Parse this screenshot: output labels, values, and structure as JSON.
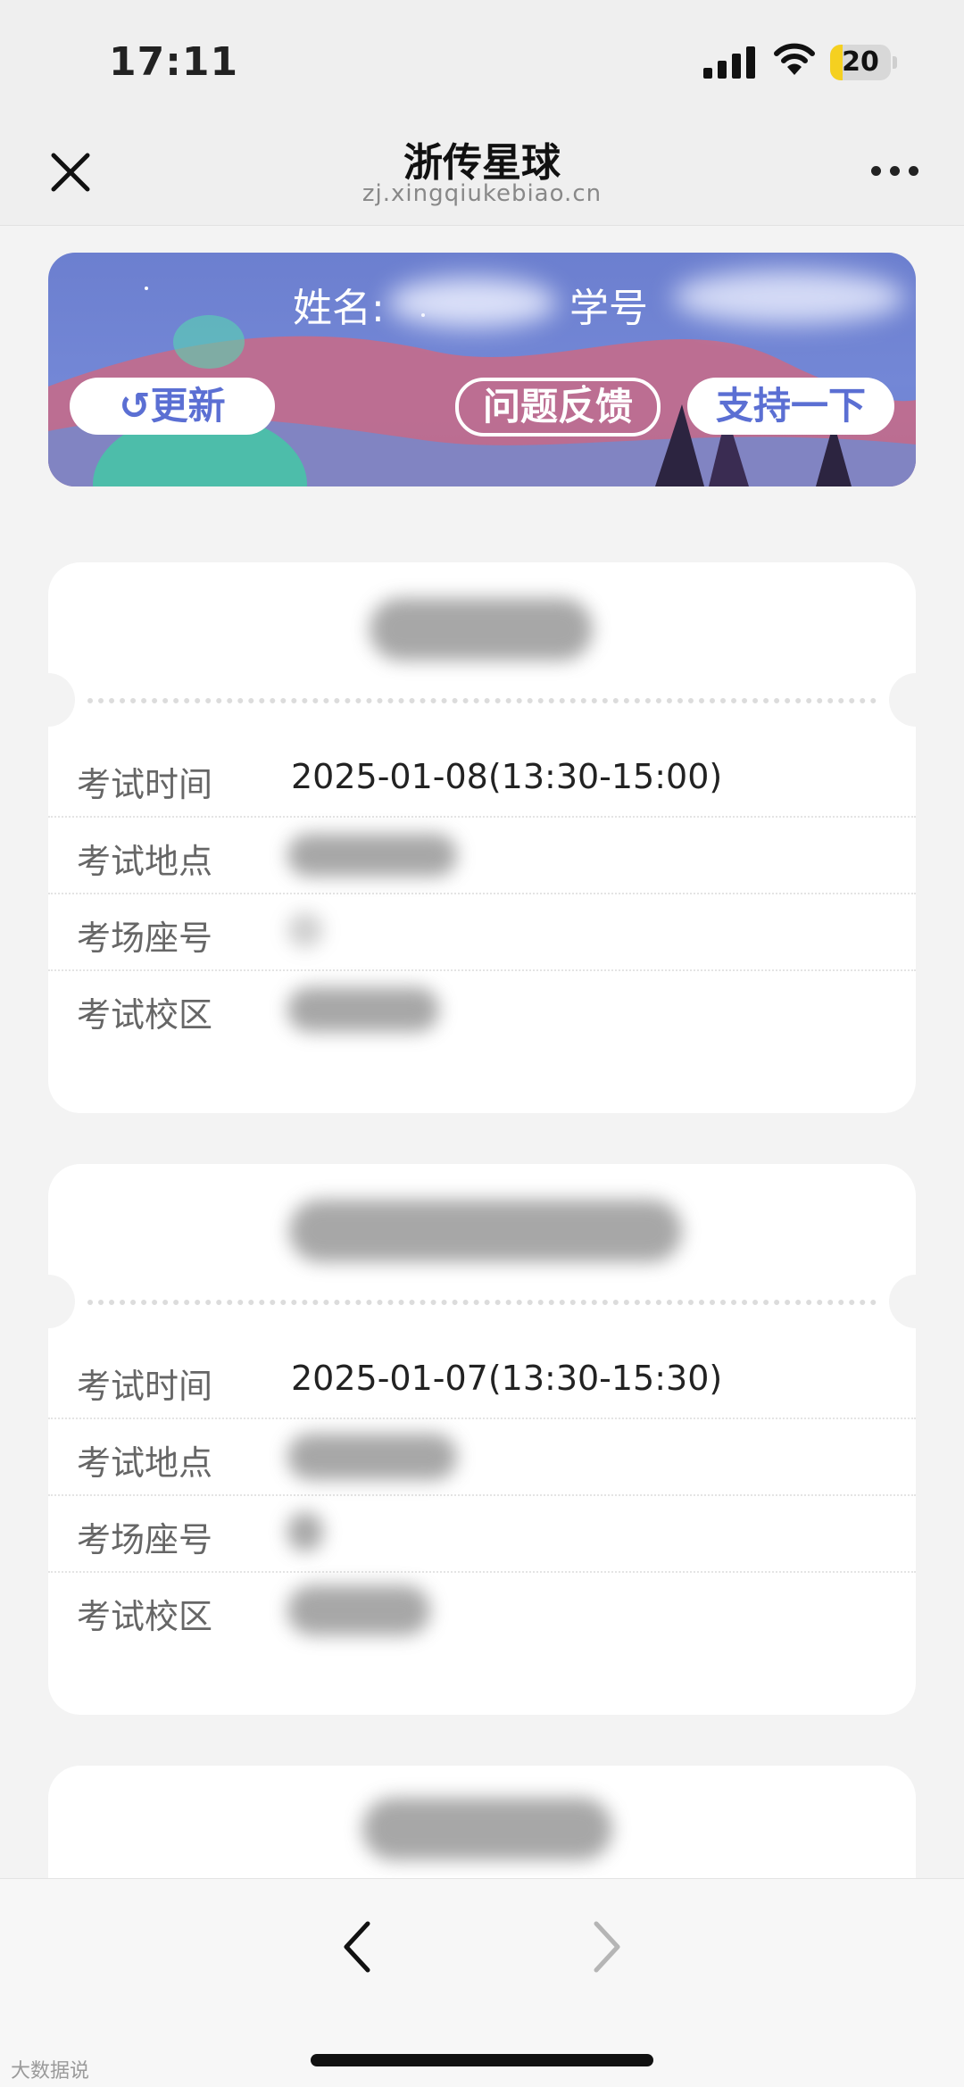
{
  "status": {
    "time": "17:11",
    "battery_level": "20"
  },
  "nav": {
    "title": "浙传星球",
    "url": "zj.xingqiukebiao.cn"
  },
  "banner": {
    "name_label": "姓名:",
    "id_label": "学号",
    "refresh_label": "↺更新",
    "feedback_label": "问题反馈",
    "support_label": "支持一下"
  },
  "cards": [
    {
      "rows": [
        {
          "label": "考试时间",
          "value": "2025-01-08(13:30-15:00)"
        },
        {
          "label": "考试地点",
          "value": ""
        },
        {
          "label": "考场座号",
          "value": ""
        },
        {
          "label": "考试校区",
          "value": ""
        }
      ]
    },
    {
      "rows": [
        {
          "label": "考试时间",
          "value": "2025-01-07(13:30-15:30)"
        },
        {
          "label": "考试地点",
          "value": ""
        },
        {
          "label": "考场座号",
          "value": ""
        },
        {
          "label": "考试校区",
          "value": ""
        }
      ]
    }
  ],
  "watermark": "大数据说"
}
